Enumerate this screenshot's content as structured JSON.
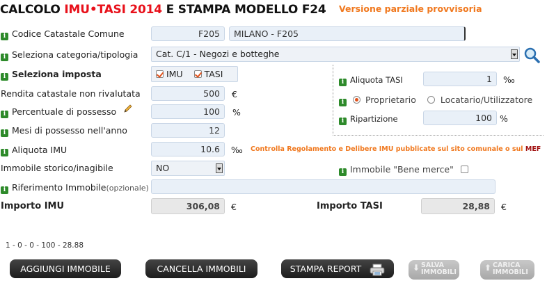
{
  "header": {
    "title_prefix": "CALCOLO ",
    "title_highlight": "IMU•TASI 2014",
    "title_suffix": " E STAMPA MODELLO F24",
    "subtitle": "Versione parziale provvisoria"
  },
  "icons": {
    "info": "info-icon",
    "search": "magnifier-icon",
    "edit": "pencil-icon",
    "print": "printer-icon",
    "save": "download-arrow-icon",
    "load": "upload-arrow-icon"
  },
  "form": {
    "codice_label": "Codice Catastale Comune",
    "codice_value": "F205",
    "comune_value": "MILANO - F205",
    "categoria_label": "Seleziona categoria/tipologia",
    "categoria_value": "Cat. C/1 - Negozi e botteghe",
    "imposta_label": "Seleziona imposta",
    "imposta_options": [
      "IMU",
      "TASI"
    ],
    "rendita_label": "Rendita catastale non rivalutata",
    "rendita_value": "500",
    "rendita_unit": "€",
    "percentuale_label": "Percentuale di possesso",
    "percentuale_value": "100",
    "percentuale_unit": "%",
    "mesi_label": "Mesi di possesso nell'anno",
    "mesi_value": "12",
    "aliquota_imu_label": "Aliquota IMU",
    "aliquota_imu_value": "10.6",
    "aliquota_imu_unit": "‰",
    "storico_label": "Immobile storico/inagibile",
    "storico_value": "NO",
    "riferimento_label": "Riferimento Immobile",
    "riferimento_optional": "(opzionale)",
    "riferimento_value": "",
    "importo_imu_label": "Importo IMU",
    "importo_imu_value": "306,08",
    "importo_imu_unit": "€"
  },
  "tasi": {
    "aliquota_label": "Aliquota TASI",
    "aliquota_value": "1",
    "aliquota_unit": "‰",
    "proprietario_label": "Proprietario",
    "locatario_label": "Locatario/Utilizzatore",
    "ripartizione_label": "Ripartizione",
    "ripartizione_value": "100",
    "ripartizione_unit": "%",
    "bene_merce_label": "Immobile \"Bene merce\"",
    "importo_label": "Importo TASI",
    "importo_value": "28,88",
    "importo_unit": "€"
  },
  "note": {
    "text": "Controlla Regolamento e Delibere IMU pubblicate sul sito comunale o sul ",
    "link": "MEF"
  },
  "status_line": "1 - 0 - 0 - 100 - 28.88",
  "buttons": {
    "add": "AGGIUNGI IMMOBILE",
    "clear": "CANCELLA IMMOBILI",
    "print": "STAMPA REPORT",
    "save_line1": "SALVA",
    "save_line2": "IMMOBILI",
    "load_line1": "CARICA",
    "load_line2": "IMMOBILI"
  },
  "colors": {
    "title_red": "#e8101a",
    "subtitle_orange": "#f0781e",
    "info_green": "#2d8a2a",
    "field_bg": "#e9f0f8",
    "button_dark": "#2a2a2a"
  }
}
